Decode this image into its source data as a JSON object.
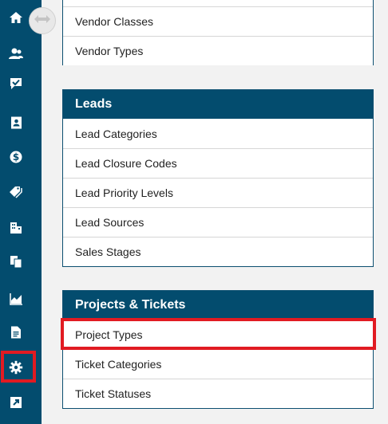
{
  "sidebar": {
    "items": [
      {
        "icon": "home-icon"
      },
      {
        "icon": "contacts-icon"
      },
      {
        "icon": "chat-check-icon"
      },
      {
        "icon": "address-book-icon"
      },
      {
        "icon": "dollar-circle-icon"
      },
      {
        "icon": "tags-icon"
      },
      {
        "icon": "buildings-icon"
      },
      {
        "icon": "copy-pages-icon"
      },
      {
        "icon": "area-chart-icon"
      },
      {
        "icon": "document-icon"
      },
      {
        "icon": "gear-icon",
        "highlighted": true
      },
      {
        "icon": "external-link-icon"
      }
    ],
    "collapse_toggle_icon": "double-arrow-icon"
  },
  "vendors_card": {
    "items": [
      "Vendor Classes",
      "Vendor Types"
    ]
  },
  "leads_card": {
    "title": "Leads",
    "items": [
      "Lead Categories",
      "Lead Closure Codes",
      "Lead Priority Levels",
      "Lead Sources",
      "Sales Stages"
    ]
  },
  "projects_card": {
    "title": "Projects & Tickets",
    "items": [
      "Project Types",
      "Ticket Categories",
      "Ticket Statuses"
    ],
    "highlighted_item": "Project Types"
  },
  "colors": {
    "sidebar": "#034c6e",
    "header": "#034c6e",
    "highlight": "#e11b22",
    "background": "#f2f2f2"
  }
}
